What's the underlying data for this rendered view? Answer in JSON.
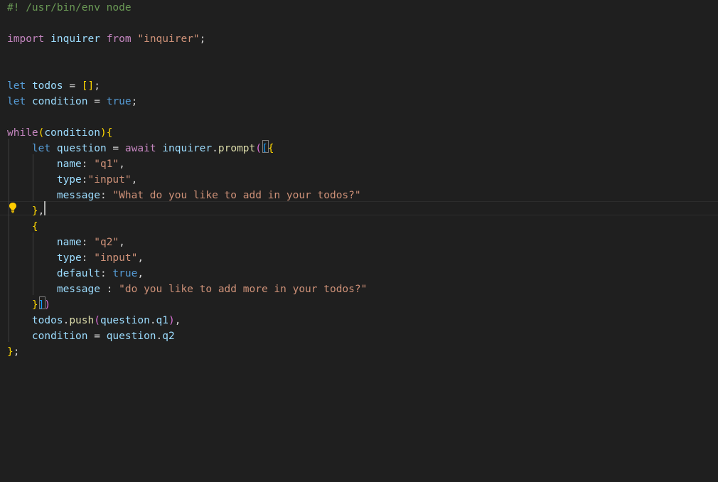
{
  "editor": {
    "lines": [
      {
        "segments": [
          {
            "t": "#! /usr/bin/env node",
            "c": "c-comment"
          }
        ]
      },
      {
        "segments": []
      },
      {
        "segments": [
          {
            "t": "import",
            "c": "c-kw"
          },
          {
            "t": " ",
            "c": "c-punc"
          },
          {
            "t": "inquirer",
            "c": "c-var"
          },
          {
            "t": " ",
            "c": "c-punc"
          },
          {
            "t": "from",
            "c": "c-kw"
          },
          {
            "t": " ",
            "c": "c-punc"
          },
          {
            "t": "\"inquirer\"",
            "c": "c-str"
          },
          {
            "t": ";",
            "c": "c-punc"
          }
        ]
      },
      {
        "segments": []
      },
      {
        "segments": []
      },
      {
        "segments": [
          {
            "t": "let",
            "c": "c-kw2"
          },
          {
            "t": " ",
            "c": "c-punc"
          },
          {
            "t": "todos",
            "c": "c-var"
          },
          {
            "t": " = ",
            "c": "c-punc"
          },
          {
            "t": "[]",
            "c": "b1"
          },
          {
            "t": ";",
            "c": "c-punc"
          }
        ]
      },
      {
        "segments": [
          {
            "t": "let",
            "c": "c-kw2"
          },
          {
            "t": " ",
            "c": "c-punc"
          },
          {
            "t": "condition",
            "c": "c-var"
          },
          {
            "t": " = ",
            "c": "c-punc"
          },
          {
            "t": "true",
            "c": "c-kw2"
          },
          {
            "t": ";",
            "c": "c-punc"
          }
        ]
      },
      {
        "segments": []
      },
      {
        "segments": [
          {
            "t": "while",
            "c": "c-kw"
          },
          {
            "t": "(",
            "c": "b1"
          },
          {
            "t": "condition",
            "c": "c-var"
          },
          {
            "t": ")",
            "c": "b1"
          },
          {
            "t": "{",
            "c": "b1"
          }
        ]
      },
      {
        "segments": [
          {
            "t": "    ",
            "c": "c-punc"
          },
          {
            "t": "let",
            "c": "c-kw2"
          },
          {
            "t": " ",
            "c": "c-punc"
          },
          {
            "t": "question",
            "c": "c-var"
          },
          {
            "t": " = ",
            "c": "c-punc"
          },
          {
            "t": "await",
            "c": "c-kw"
          },
          {
            "t": " ",
            "c": "c-punc"
          },
          {
            "t": "inquirer",
            "c": "c-var"
          },
          {
            "t": ".",
            "c": "c-punc"
          },
          {
            "t": "prompt",
            "c": "c-fn"
          },
          {
            "t": "(",
            "c": "b2"
          },
          {
            "t": "[",
            "c": "b3"
          },
          {
            "t": "{",
            "c": "b1"
          }
        ]
      },
      {
        "segments": [
          {
            "t": "        ",
            "c": "c-punc"
          },
          {
            "t": "name",
            "c": "c-var"
          },
          {
            "t": ": ",
            "c": "c-punc"
          },
          {
            "t": "\"q1\"",
            "c": "c-str"
          },
          {
            "t": ",",
            "c": "c-punc"
          }
        ]
      },
      {
        "segments": [
          {
            "t": "        ",
            "c": "c-punc"
          },
          {
            "t": "type",
            "c": "c-var"
          },
          {
            "t": ":",
            "c": "c-punc"
          },
          {
            "t": "\"input\"",
            "c": "c-str"
          },
          {
            "t": ",",
            "c": "c-punc"
          }
        ]
      },
      {
        "segments": [
          {
            "t": "        ",
            "c": "c-punc"
          },
          {
            "t": "message",
            "c": "c-var"
          },
          {
            "t": ": ",
            "c": "c-punc"
          },
          {
            "t": "\"What do you like to add in your todos?\"",
            "c": "c-str"
          }
        ]
      },
      {
        "segments": [
          {
            "t": "    ",
            "c": "c-punc"
          },
          {
            "t": "}",
            "c": "b1"
          },
          {
            "t": ",",
            "c": "c-punc"
          }
        ]
      },
      {
        "segments": [
          {
            "t": "    ",
            "c": "c-punc"
          },
          {
            "t": "{",
            "c": "b1"
          }
        ]
      },
      {
        "segments": [
          {
            "t": "        ",
            "c": "c-punc"
          },
          {
            "t": "name",
            "c": "c-var"
          },
          {
            "t": ": ",
            "c": "c-punc"
          },
          {
            "t": "\"q2\"",
            "c": "c-str"
          },
          {
            "t": ",",
            "c": "c-punc"
          }
        ]
      },
      {
        "segments": [
          {
            "t": "        ",
            "c": "c-punc"
          },
          {
            "t": "type",
            "c": "c-var"
          },
          {
            "t": ": ",
            "c": "c-punc"
          },
          {
            "t": "\"input\"",
            "c": "c-str"
          },
          {
            "t": ",",
            "c": "c-punc"
          }
        ]
      },
      {
        "segments": [
          {
            "t": "        ",
            "c": "c-punc"
          },
          {
            "t": "default",
            "c": "c-var"
          },
          {
            "t": ": ",
            "c": "c-punc"
          },
          {
            "t": "true",
            "c": "c-kw2"
          },
          {
            "t": ",",
            "c": "c-punc"
          }
        ]
      },
      {
        "segments": [
          {
            "t": "        ",
            "c": "c-punc"
          },
          {
            "t": "message",
            "c": "c-var"
          },
          {
            "t": " : ",
            "c": "c-punc"
          },
          {
            "t": "\"do you like to add more in your todos?\"",
            "c": "c-str"
          }
        ]
      },
      {
        "segments": [
          {
            "t": "    ",
            "c": "c-punc"
          },
          {
            "t": "}",
            "c": "b1"
          },
          {
            "t": "]",
            "c": "b3"
          },
          {
            "t": ")",
            "c": "b2"
          }
        ]
      },
      {
        "segments": [
          {
            "t": "    ",
            "c": "c-punc"
          },
          {
            "t": "todos",
            "c": "c-var"
          },
          {
            "t": ".",
            "c": "c-punc"
          },
          {
            "t": "push",
            "c": "c-fn"
          },
          {
            "t": "(",
            "c": "b2"
          },
          {
            "t": "question",
            "c": "c-var"
          },
          {
            "t": ".",
            "c": "c-punc"
          },
          {
            "t": "q1",
            "c": "c-var"
          },
          {
            "t": ")",
            "c": "b2"
          },
          {
            "t": ",",
            "c": "c-punc"
          }
        ]
      },
      {
        "segments": [
          {
            "t": "    ",
            "c": "c-punc"
          },
          {
            "t": "condition",
            "c": "c-var"
          },
          {
            "t": " = ",
            "c": "c-punc"
          },
          {
            "t": "question",
            "c": "c-var"
          },
          {
            "t": ".",
            "c": "c-punc"
          },
          {
            "t": "q2",
            "c": "c-var"
          }
        ]
      },
      {
        "segments": [
          {
            "t": "}",
            "c": "b1"
          },
          {
            "t": ";",
            "c": "c-punc"
          }
        ]
      }
    ]
  },
  "icons": {
    "lightbulb": "lightbulb-icon"
  },
  "colors": {
    "background": "#1f1f1f",
    "comment": "#6a9955",
    "keyword_control": "#c586c0",
    "keyword": "#569cd6",
    "variable": "#9cdcfe",
    "function": "#dcdcaa",
    "string": "#ce9178",
    "bracket_1": "#ffd700",
    "bracket_2": "#da70d6",
    "bracket_3": "#179fff",
    "lightbulb": "#ffcc00"
  }
}
